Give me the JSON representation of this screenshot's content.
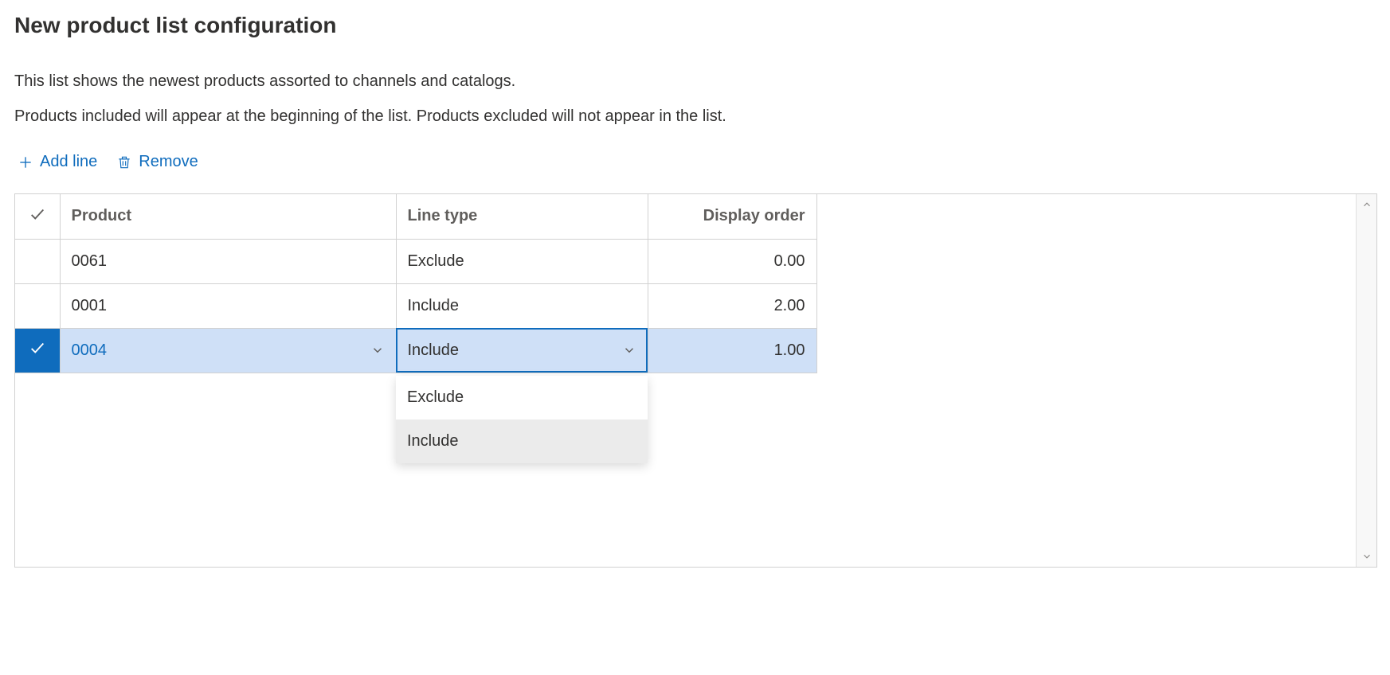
{
  "header": {
    "title": "New product list configuration",
    "desc1": "This list shows the newest products assorted to channels and catalogs.",
    "desc2": "Products included will appear at the beginning of the list. Products excluded will not appear in the list."
  },
  "toolbar": {
    "add_line": "Add line",
    "remove": "Remove"
  },
  "grid": {
    "columns": {
      "product": "Product",
      "line_type": "Line type",
      "display_order": "Display order"
    },
    "rows": [
      {
        "product": "0061",
        "line_type": "Exclude",
        "display_order": "0.00"
      },
      {
        "product": "0001",
        "line_type": "Include",
        "display_order": "2.00"
      },
      {
        "product": "0004",
        "line_type": "Include",
        "display_order": "1.00"
      }
    ]
  },
  "dropdown": {
    "options": [
      "Exclude",
      "Include"
    ]
  }
}
